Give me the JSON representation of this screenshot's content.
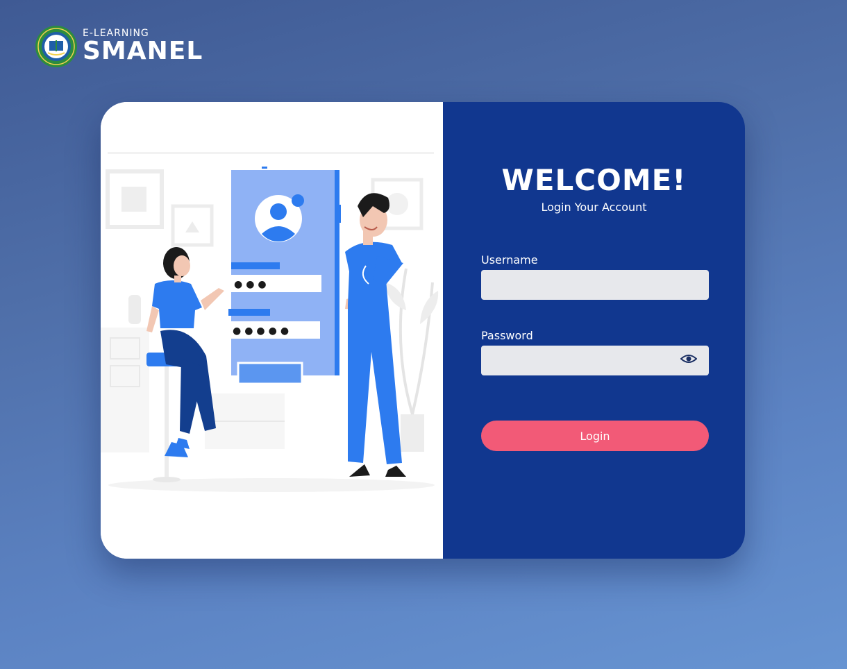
{
  "brand": {
    "subtitle": "E-LEARNING",
    "name": "SMANEL"
  },
  "illustration": {
    "password_dots_1": "●●●",
    "password_dots_2": "●●●●●"
  },
  "form": {
    "title": "WELCOME!",
    "subtitle": "Login Your Account",
    "username_label": "Username",
    "username_value": "",
    "password_label": "Password",
    "password_value": "",
    "toggle_icon": "eye-icon",
    "login_label": "Login"
  },
  "colors": {
    "panel": "#11378f",
    "button": "#f25a77",
    "input_bg": "#e7e8ec",
    "accent_blue": "#2d7bef"
  }
}
